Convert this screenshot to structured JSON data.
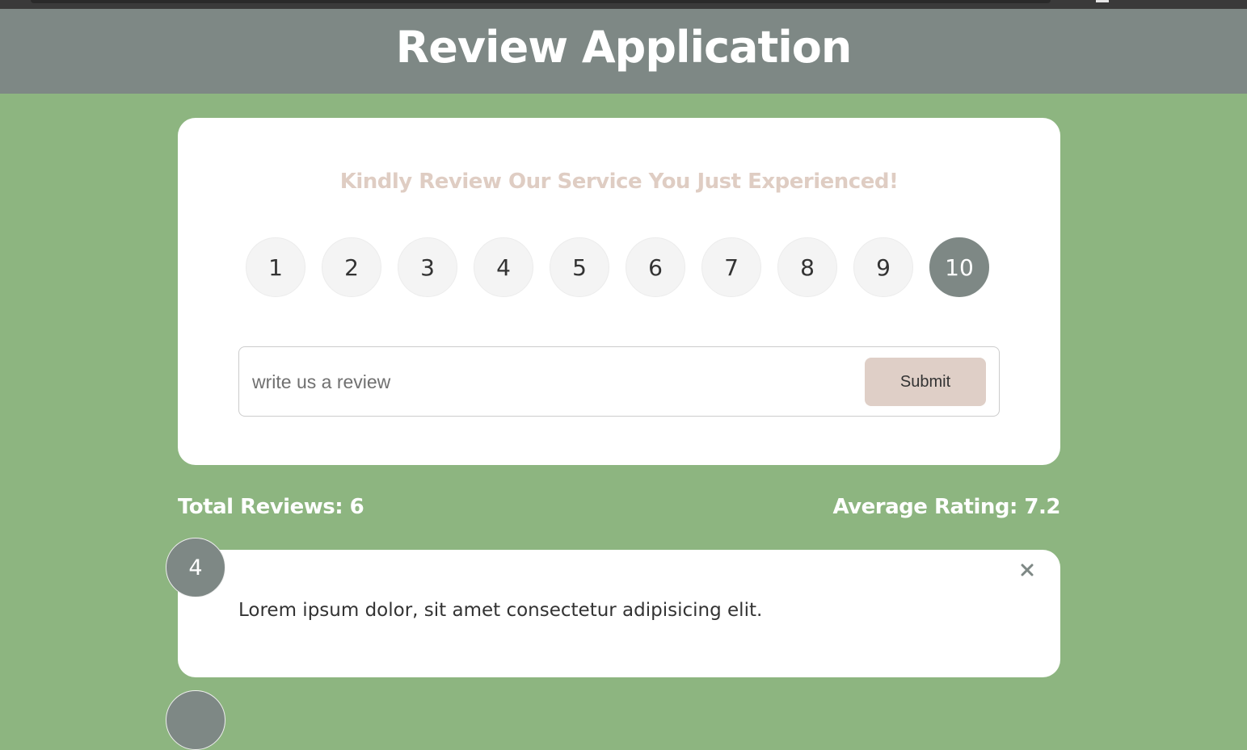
{
  "header": {
    "title": "Review Application"
  },
  "review_card": {
    "prompt": "Kindly Review Our Service You Just Experienced!",
    "ratings": [
      "1",
      "2",
      "3",
      "4",
      "5",
      "6",
      "7",
      "8",
      "9",
      "10"
    ],
    "selected_rating": "10",
    "input_placeholder": "write us a review",
    "input_value": "",
    "submit_label": "Submit"
  },
  "stats": {
    "total_reviews": "Total Reviews: 6",
    "average_rating": "Average Rating: 7.2"
  },
  "reviews": [
    {
      "rating": "4",
      "text": "Lorem ipsum dolor, sit amet consectetur adipisicing elit."
    }
  ],
  "icons": {
    "close": "close-icon"
  },
  "colors": {
    "page_background": "#8db580",
    "header_background": "#7e8885",
    "prompt_text": "#dfcdc3",
    "selected_rating": "#7e8885",
    "submit_button": "#dfcfc7"
  }
}
